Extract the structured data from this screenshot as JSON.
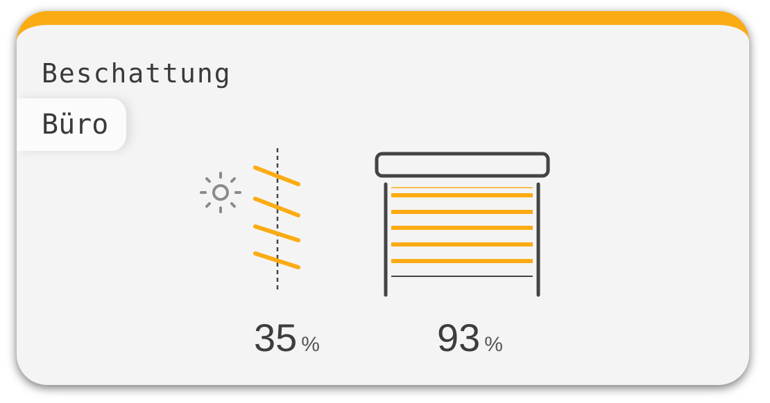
{
  "card": {
    "title": "Beschattung",
    "room": "Büro",
    "accent_color": "#fbab13"
  },
  "slats": {
    "icon": "sun-icon",
    "value": "35",
    "unit": "%",
    "angle_percent": 35
  },
  "shutter": {
    "icon": "roller-shutter-icon",
    "value": "93",
    "unit": "%",
    "position_percent": 93
  }
}
